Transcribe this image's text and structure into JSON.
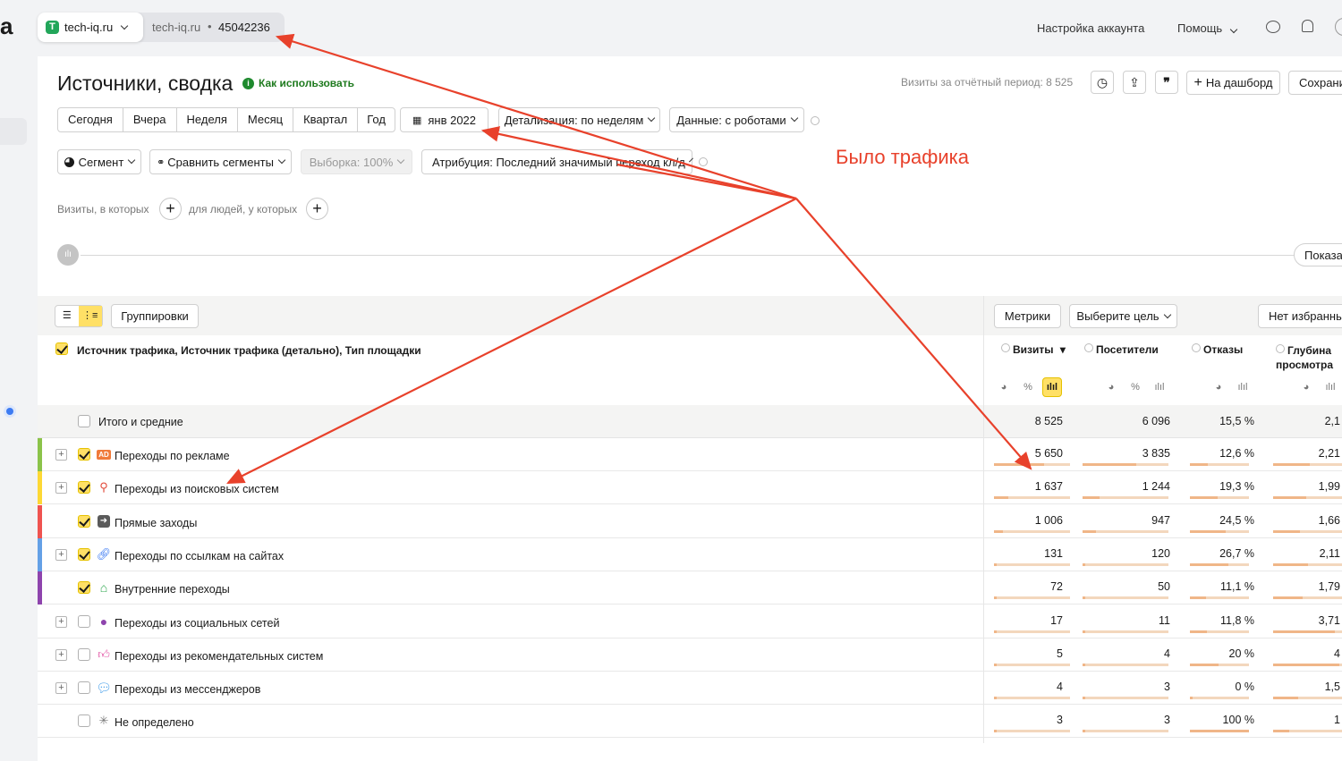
{
  "topbar": {
    "logo_fragment": "a",
    "counter_site": "tech-iq.ru",
    "counter_site2": "tech-iq.ru",
    "counter_id": "45042236",
    "account_settings": "Настройка аккаунта",
    "help": "Помощь"
  },
  "header": {
    "title": "Источники, сводка",
    "how_to_use": "Как использовать",
    "visits_period": "Визиты за отчётный период: 8 525",
    "dashboard_button": "На дашборд",
    "save_button": "Сохрани"
  },
  "periods": [
    "Сегодня",
    "Вчера",
    "Неделя",
    "Месяц",
    "Квартал",
    "Год"
  ],
  "date_button": "янв 2022",
  "detail_dropdown": "Детализация: по неделям",
  "data_dropdown": "Данные: с роботами",
  "segment_dropdown": "Сегмент",
  "compare_dropdown": "Сравнить сегменты",
  "sample_dropdown": "Выборка: 100%",
  "attribution_dropdown": "Атрибуция: Последний значимый переход  кл/д",
  "filters": {
    "visits_label": "Визиты, в которых",
    "people_label": "для людей, у которых"
  },
  "show_button": "Показат",
  "annotation": {
    "text": "Было трафика",
    "color": "#e8412b"
  },
  "table_toolbar": {
    "groupings": "Группировки",
    "metrics": "Метрики",
    "goal": "Выберите цель",
    "favorites": "Нет избранны"
  },
  "table": {
    "dimension_header": "Источник трафика, Источник трафика (детально), Тип площадки",
    "columns": [
      "Визиты",
      "Посетители",
      "Отказы",
      "Глубина просмотра"
    ],
    "sort_indicator": "▾",
    "totals": {
      "label": "Итого и средние",
      "values": [
        "8 525",
        "6 096",
        "15,5 %",
        "2,1"
      ]
    },
    "rows": [
      {
        "label": "Переходы по рекламе",
        "icon": "ad-icon",
        "color": "#8bc34a",
        "expandable": true,
        "checked": true,
        "values": [
          "5 650",
          "3 835",
          "12,6 %",
          "2,21"
        ],
        "fractions": [
          0.66,
          0.63,
          0.31,
          0.51
        ]
      },
      {
        "label": "Переходы из поисковых систем",
        "icon": "search-icon",
        "color": "#fdd835",
        "expandable": true,
        "checked": true,
        "values": [
          "1 637",
          "1 244",
          "19,3 %",
          "1,99"
        ],
        "fractions": [
          0.19,
          0.2,
          0.47,
          0.46
        ]
      },
      {
        "label": "Прямые заходы",
        "icon": "direct-arrow-icon",
        "color": "#ef5350",
        "expandable": false,
        "checked": true,
        "values": [
          "1 006",
          "947",
          "24,5 %",
          "1,66"
        ],
        "fractions": [
          0.12,
          0.16,
          0.6,
          0.38
        ]
      },
      {
        "label": "Переходы по ссылкам на сайтах",
        "icon": "link-icon",
        "color": "#64a0e6",
        "expandable": true,
        "checked": true,
        "values": [
          "131",
          "120",
          "26,7 %",
          "2,11"
        ],
        "fractions": [
          0.03,
          0.03,
          0.65,
          0.49
        ]
      },
      {
        "label": "Внутренние переходы",
        "icon": "home-icon",
        "color": "#8e44ad",
        "expandable": false,
        "checked": true,
        "values": [
          "72",
          "50",
          "11,1 %",
          "1,79"
        ],
        "fractions": [
          0.02,
          0.02,
          0.27,
          0.41
        ]
      },
      {
        "label": "Переходы из социальных сетей",
        "icon": "social-icon",
        "color": "",
        "expandable": true,
        "checked": false,
        "values": [
          "17",
          "11",
          "11,8 %",
          "3,71"
        ],
        "fractions": [
          0.01,
          0.01,
          0.29,
          0.86
        ]
      },
      {
        "label": "Переходы из рекомендательных систем",
        "icon": "thumbs-up-icon",
        "color": "",
        "expandable": true,
        "checked": false,
        "values": [
          "5",
          "4",
          "20 %",
          "4"
        ],
        "fractions": [
          0.01,
          0.01,
          0.49,
          0.93
        ]
      },
      {
        "label": "Переходы из мессенджеров",
        "icon": "messenger-icon",
        "color": "",
        "expandable": true,
        "checked": false,
        "values": [
          "4",
          "3",
          "0 %",
          "1,5"
        ],
        "fractions": [
          0.01,
          0.01,
          0.0,
          0.35
        ]
      },
      {
        "label": "Не определено",
        "icon": "undefined-icon",
        "color": "",
        "expandable": false,
        "checked": false,
        "values": [
          "3",
          "3",
          "100 %",
          "1"
        ],
        "fractions": [
          0.01,
          0.01,
          1.0,
          0.23
        ]
      }
    ]
  }
}
